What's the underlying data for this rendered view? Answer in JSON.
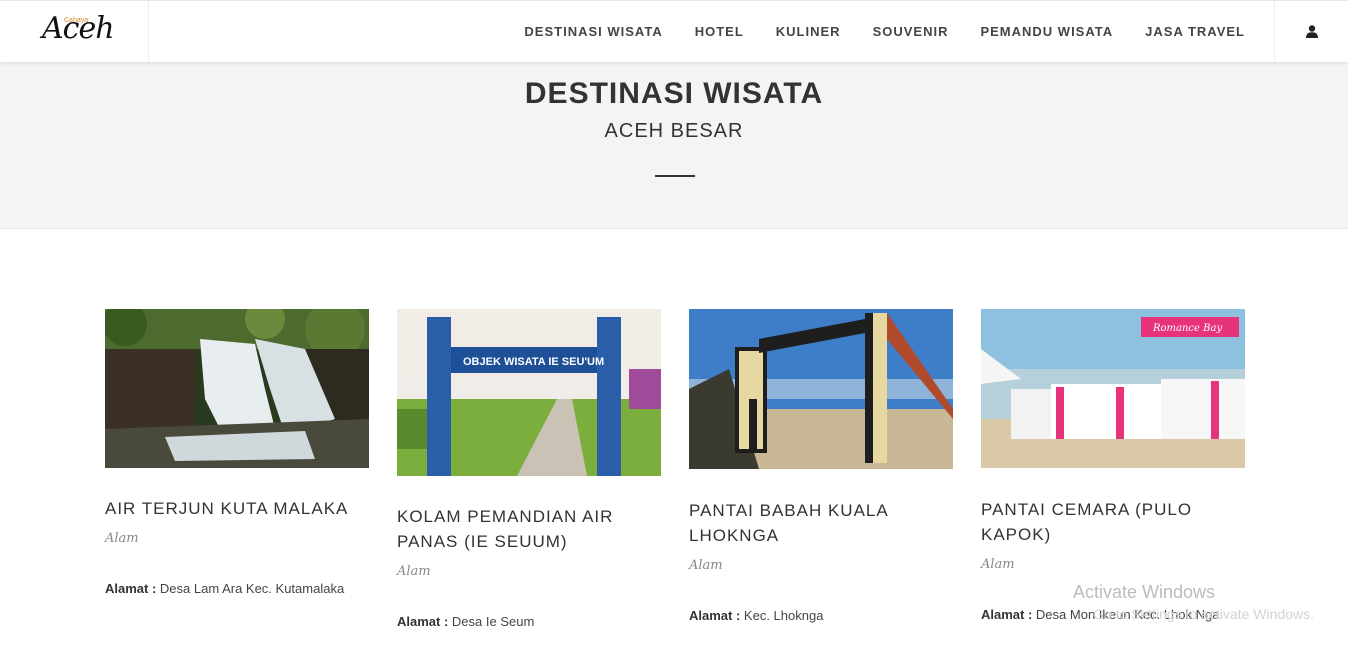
{
  "header": {
    "logo_small": "Cahaya",
    "logo_text": "Aceh",
    "nav": [
      "DESTINASI WISATA",
      "HOTEL",
      "KULINER",
      "SOUVENIR",
      "PEMANDU WISATA",
      "JASA TRAVEL"
    ],
    "user_icon": "user-icon"
  },
  "hero": {
    "title": "DESTINASI WISATA",
    "subtitle": "ACEH BESAR"
  },
  "cards": [
    {
      "title": "AIR TERJUN KUTA MALAKA",
      "category": "Alam",
      "address_label": "Alamat :",
      "address": "Desa Lam Ara Kec. Kutamalaka"
    },
    {
      "title": "KOLAM PEMANDIAN AIR PANAS (IE SEUUM)",
      "category": "Alam",
      "address_label": "Alamat :",
      "address": "Desa Ie Seum",
      "sign_text": "OBJEK WISATA IE SEU'UM"
    },
    {
      "title": "PANTAI BABAH KUALA LHOKNGA",
      "category": "Alam",
      "address_label": "Alamat :",
      "address": "Kec. Lhoknga"
    },
    {
      "title": "PANTAI CEMARA (PULO KAPOK)",
      "category": "Alam",
      "address_label": "Alamat :",
      "address": "Desa Mon Ikeun Kec. Lhok Nga",
      "banner_text": "Romance Bay"
    }
  ],
  "watermark": {
    "line1": "Activate Windows",
    "line2": "Go to Settings to activate Windows."
  },
  "colors": {
    "hero_bg": "#f4f4f4",
    "text": "#333333",
    "accent_pink": "#e7327c"
  }
}
